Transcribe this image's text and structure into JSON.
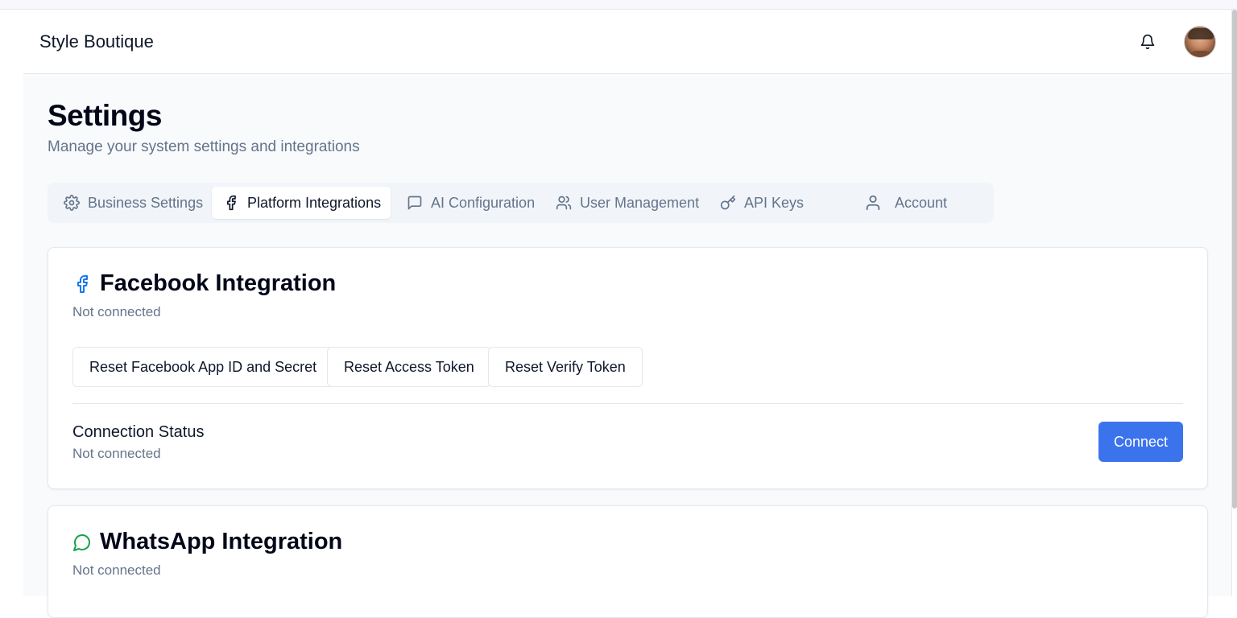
{
  "header": {
    "brand": "Style Boutique"
  },
  "page": {
    "title": "Settings",
    "subtitle": "Manage your system settings and integrations"
  },
  "tabs": [
    {
      "label": "Business Settings",
      "icon": "gear-icon"
    },
    {
      "label": "Platform Integrations",
      "icon": "facebook-icon",
      "active": true
    },
    {
      "label": "AI Configuration",
      "icon": "message-square-icon"
    },
    {
      "label": "User Management",
      "icon": "users-icon"
    },
    {
      "label": "API Keys",
      "icon": "key-icon"
    },
    {
      "label": "Account",
      "icon": "user-icon"
    }
  ],
  "facebook": {
    "title": "Facebook Integration",
    "status": "Not connected",
    "buttons": [
      "Reset Facebook App ID and Secret",
      "Reset Access Token",
      "Reset Verify Token"
    ],
    "connection_label": "Connection Status",
    "connection_value": "Not connected",
    "connect_label": "Connect"
  },
  "whatsapp": {
    "title": "WhatsApp Integration",
    "status": "Not connected"
  },
  "colors": {
    "primary": "#3b73ed",
    "facebook": "#1877f2",
    "whatsapp": "#16a34a"
  }
}
